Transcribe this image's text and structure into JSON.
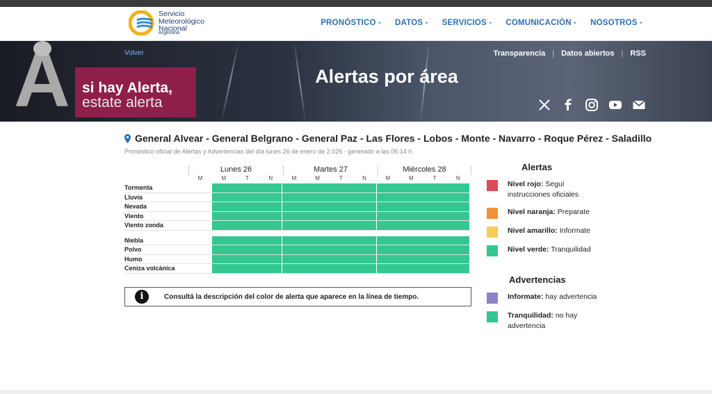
{
  "brand": {
    "name_line1": "Servicio",
    "name_line2": "Meteorológico",
    "name_line3": "Nacional",
    "country": "Argentina"
  },
  "nav": {
    "items": [
      {
        "label": "PRONÓSTICO -"
      },
      {
        "label": "DATOS -"
      },
      {
        "label": "SERVICIOS -"
      },
      {
        "label": "COMUNICACIÓN -"
      },
      {
        "label": "NOSOTROS -"
      }
    ]
  },
  "hero": {
    "back_label": "Volver",
    "links": [
      "Transparencia",
      "Datos abiertos",
      "RSS"
    ],
    "link_sep": "|",
    "title": "Alertas por área",
    "promo_line1": "si hay Alerta,",
    "promo_line2": "estate alerta",
    "social_icons": [
      "x-icon",
      "facebook-icon",
      "instagram-icon",
      "youtube-icon",
      "mail-icon"
    ]
  },
  "location": {
    "areas": "General Alvear - General Belgrano - General Paz - Las Flores - Lobos - Monte - Navarro - Roque Pérez - Saladillo",
    "subtitle": "Pronóstico oficial de Alertas y Advertencias del día lunes 26 de enero de 2.026 - generado a las 06:14 h"
  },
  "forecast": {
    "days": [
      "Lunes 26",
      "Martes 27",
      "Miércoles 28"
    ],
    "periods": [
      "M",
      "M",
      "T",
      "N",
      "M",
      "M",
      "T",
      "N",
      "M",
      "M",
      "T",
      "N"
    ],
    "group1": [
      "Tormenta",
      "Lluvia",
      "Nevada",
      "Viento",
      "Viento zonda"
    ],
    "group2": [
      "Niebla",
      "Polvo",
      "Humo",
      "Ceniza volcánica"
    ],
    "level_color": "#35c792"
  },
  "notice": {
    "text": "Consultá la descripción del color de alerta que aparece en la línea de tiempo.",
    "icon": "info-icon"
  },
  "legend": {
    "alerts_title": "Alertas",
    "alerts": [
      {
        "bold": "Nivel rojo:",
        "text": " Seguí instrucciones oficiales",
        "color": "#dc4b5a"
      },
      {
        "bold": "Nivel naranja:",
        "text": " Preparate",
        "color": "#f0913a"
      },
      {
        "bold": "Nivel amarillo:",
        "text": " Informate",
        "color": "#f5cd5a"
      },
      {
        "bold": "Nivel verde:",
        "text": " Tranquilidad",
        "color": "#35c792"
      }
    ],
    "warnings_title": "Advertencias",
    "warnings": [
      {
        "bold": "Informate:",
        "text": " hay advertencia",
        "color": "#9080c8"
      },
      {
        "bold": "Tranquilidad:",
        "text": " no hay advertencia",
        "color": "#35c792"
      }
    ]
  }
}
